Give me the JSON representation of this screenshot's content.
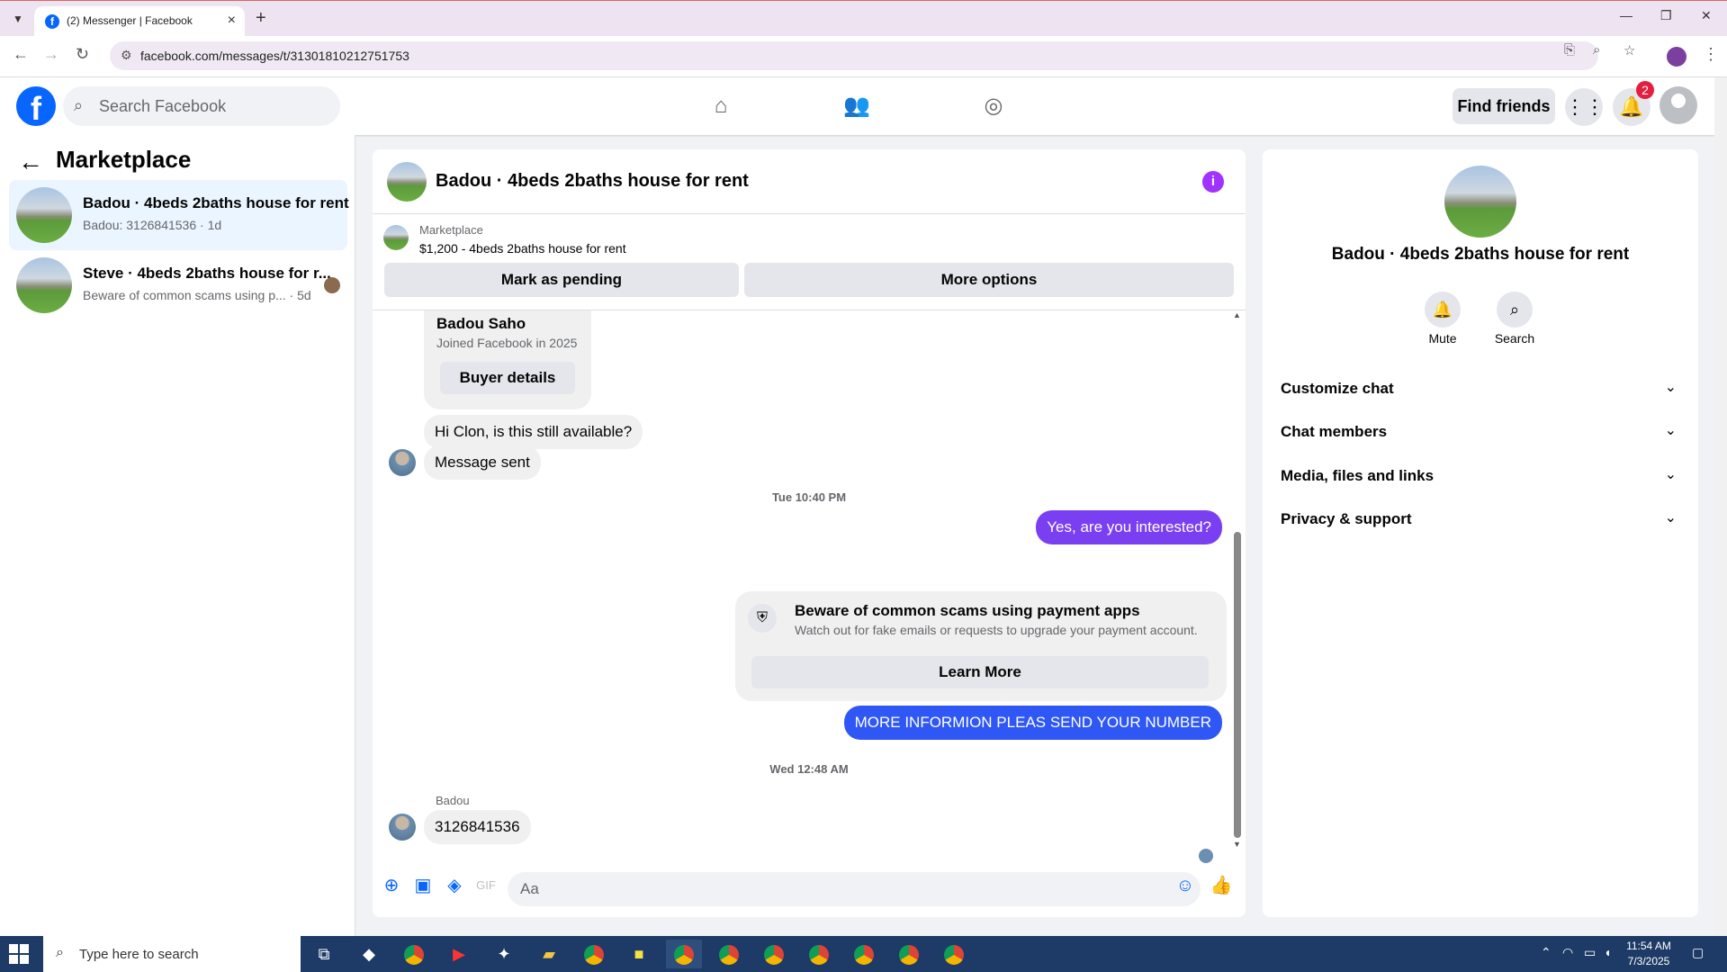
{
  "browser": {
    "tab_title": "(2) Messenger | Facebook",
    "url": "facebook.com/messages/t/31301810212751753"
  },
  "header": {
    "search_placeholder": "Search Facebook",
    "find_friends_label": "Find friends",
    "notification_count": "2"
  },
  "sidebar": {
    "title": "Marketplace",
    "conversations": [
      {
        "name": "Badou · 4beds 2baths house for rent",
        "preview": "Badou: 3126841536 · 1d",
        "active": true
      },
      {
        "name": "Steve · 4beds 2baths house for r...",
        "preview": "Beware of common scams using p... · 5d",
        "active": false
      }
    ]
  },
  "chat": {
    "title": "Badou · 4beds 2baths house for rent",
    "marketplace_label": "Marketplace",
    "listing": "$1,200 - 4beds 2baths house for rent",
    "mark_pending_label": "Mark as pending",
    "more_options_label": "More options",
    "profile_card": {
      "name": "Badou Saho",
      "joined": "Joined Facebook in 2025",
      "button": "Buyer details"
    },
    "msg_available": "Hi Clon, is this still available?",
    "msg_sent": "Message sent",
    "timestamp1": "Tue 10:40 PM",
    "msg_interested": "Yes, are you interested?",
    "scam": {
      "title": "Beware of common scams using payment apps",
      "subtitle": "Watch out for fake emails or requests to upgrade your payment account.",
      "button": "Learn More"
    },
    "msg_info": "MORE INFORMION PLEAS SEND YOUR NUMBER",
    "timestamp2": "Wed 12:48 AM",
    "sender_label": "Badou",
    "msg_number": "3126841536",
    "composer_placeholder": "Aa"
  },
  "details": {
    "name": "Badou · 4beds 2baths house for rent",
    "mute_label": "Mute",
    "search_label": "Search",
    "sections": [
      "Customize chat",
      "Chat members",
      "Media, files and links",
      "Privacy & support"
    ]
  },
  "taskbar": {
    "search_placeholder": "Type here to search",
    "time": "11:54 AM",
    "date": "7/3/2025"
  }
}
